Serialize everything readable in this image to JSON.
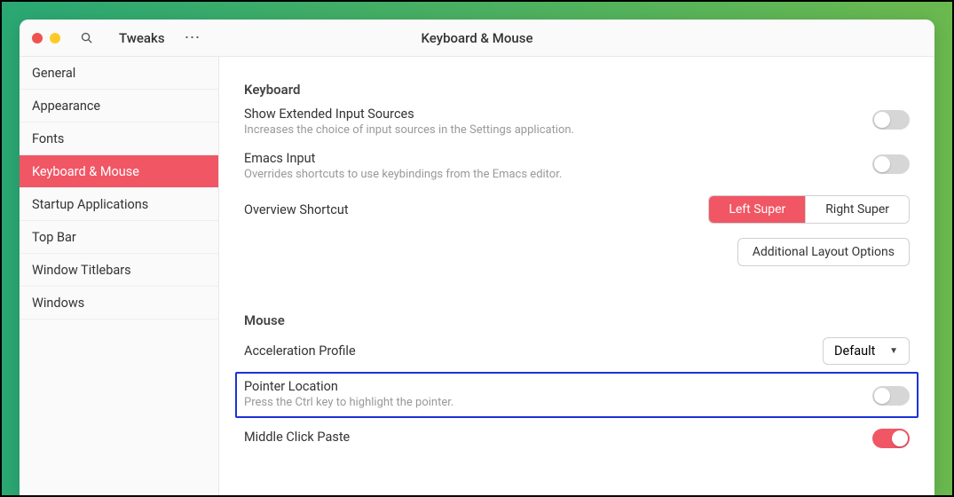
{
  "window": {
    "app_title": "Tweaks",
    "page_title": "Keyboard & Mouse"
  },
  "sidebar": {
    "items": [
      {
        "label": "General",
        "active": false
      },
      {
        "label": "Appearance",
        "active": false
      },
      {
        "label": "Fonts",
        "active": false
      },
      {
        "label": "Keyboard & Mouse",
        "active": true
      },
      {
        "label": "Startup Applications",
        "active": false
      },
      {
        "label": "Top Bar",
        "active": false
      },
      {
        "label": "Window Titlebars",
        "active": false
      },
      {
        "label": "Windows",
        "active": false
      }
    ]
  },
  "keyboard": {
    "heading": "Keyboard",
    "extended_sources": {
      "label": "Show Extended Input Sources",
      "desc": "Increases the choice of input sources in the Settings application.",
      "on": false
    },
    "emacs": {
      "label": "Emacs Input",
      "desc": "Overrides shortcuts to use keybindings from the Emacs editor.",
      "on": false
    },
    "overview": {
      "label": "Overview Shortcut",
      "left": "Left Super",
      "right": "Right Super",
      "selected": "left"
    },
    "additional_btn": "Additional Layout Options"
  },
  "mouse": {
    "heading": "Mouse",
    "accel": {
      "label": "Acceleration Profile",
      "value": "Default"
    },
    "pointer": {
      "label": "Pointer Location",
      "desc": "Press the Ctrl key to highlight the pointer.",
      "on": false
    },
    "middle_click": {
      "label": "Middle Click Paste",
      "on": true
    }
  }
}
